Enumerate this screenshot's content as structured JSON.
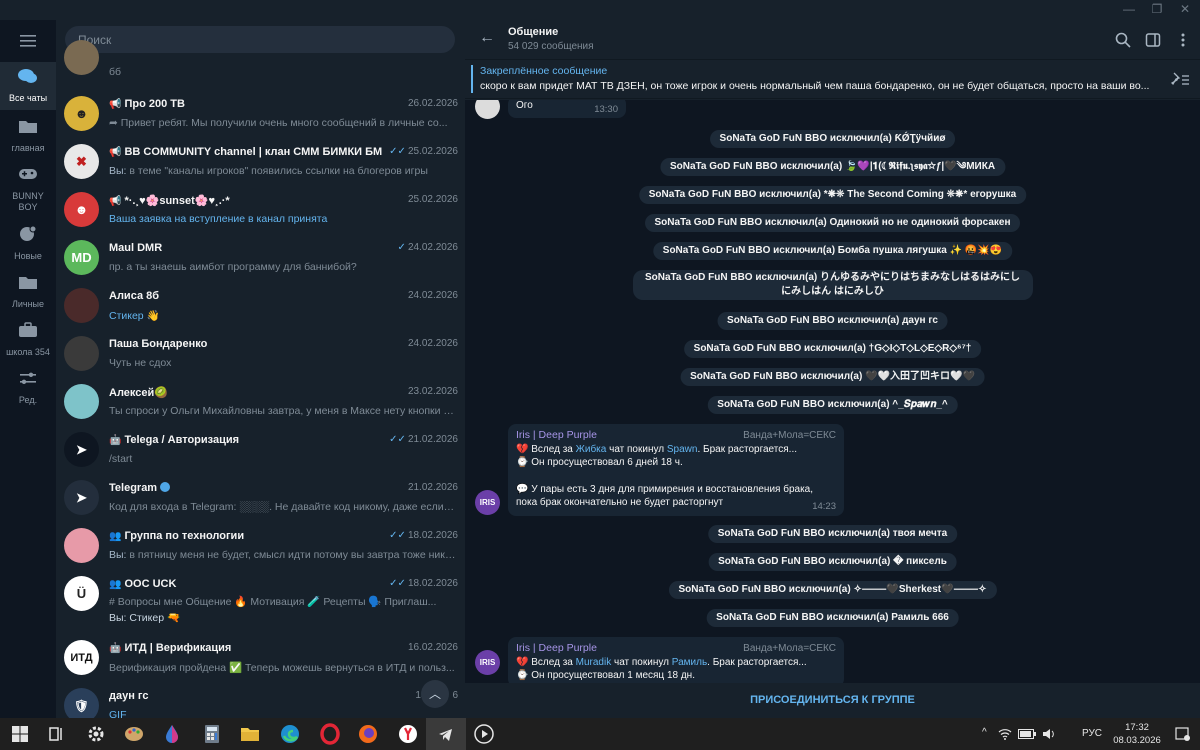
{
  "rail": {
    "items": [
      {
        "label": "Все чаты",
        "icon": "chat-bubbles-icon"
      },
      {
        "label": "главная",
        "icon": "folder-icon"
      },
      {
        "label": "BUNNY BOY",
        "icon": "gamepad-icon"
      },
      {
        "label": "Новые",
        "icon": "chat-new-icon"
      },
      {
        "label": "Личные",
        "icon": "folder-icon"
      },
      {
        "label": "школа 354",
        "icon": "briefcase-icon"
      },
      {
        "label": "Ред.",
        "icon": "sliders-icon"
      }
    ]
  },
  "search": {
    "placeholder": "Поиск"
  },
  "chats": [
    {
      "name": "",
      "date": "",
      "msg": "бб"
    },
    {
      "name": "Про 200 ТВ",
      "date": "26.02.2026",
      "msg": "Привет ребят. Мы получили очень много сообщений в личные со..."
    },
    {
      "name": "BB COMMUNITY channel | клан СММ БИМКИ БМ",
      "date": "25.02.2026",
      "sender": "Вы:",
      "msg": "в теме \"каналы игроков\" появились ссылки на блогеров игры"
    },
    {
      "name": "*·.¸♥🌸sunset🌸♥¸.·*",
      "date": "25.02.2026",
      "msg": "Ваша заявка на вступление в канал принята"
    },
    {
      "name": "Maul DMR",
      "initials": "MD",
      "date": "24.02.2026",
      "msg": "пр. а ты знаешь аимбот программу для баннибой?"
    },
    {
      "name": "Алиса 8б",
      "date": "24.02.2026",
      "msg": "Стикер 👋"
    },
    {
      "name": "Паша Бондаренко",
      "date": "24.02.2026",
      "msg": "Чуть не сдох"
    },
    {
      "name": "Алексей🥝",
      "date": "23.02.2026",
      "msg": "Ты спроси у Ольги Михайловны завтра, у меня в Максе нету кнопки д..."
    },
    {
      "name": "Telega / Авторизация",
      "date": "21.02.2026",
      "msg": "/start"
    },
    {
      "name": "Telegram",
      "date": "21.02.2026",
      "msg": "Код для входа в Telegram: ░░░░. Не давайте код никому, даже если ег..."
    },
    {
      "name": "Группа по технологии",
      "date": "18.02.2026",
      "sender": "Вы:",
      "msg": "в пятницу меня не будет, смысл идти потому вы завтра тоже никт..."
    },
    {
      "name": "OOC UCK",
      "date": "18.02.2026",
      "msg": "# Вопросы мне  Общение  🔥 Мотивация  🧪 Рецепты  🗣️ Приглаш...",
      "msg2": "Вы: Стикер 🔫"
    },
    {
      "name": "ИТД | Верификация",
      "initials": "ИТД",
      "date": "16.02.2026",
      "msg": "Верификация пройдена ✅  Теперь можешь вернуться в ИТД и польз..."
    },
    {
      "name": "даун гс",
      "date": "13",
      "date_tail": "6",
      "msg": "GIF"
    }
  ],
  "header": {
    "title": "Общение",
    "subtitle": "54 029 сообщения"
  },
  "pinned": {
    "title": "Закреплённое сообщение",
    "text": "скоро к вам придет МАТ ТВ ДЗЕН, он тоже игрок и очень нормальный чем паша бондаренко, он не будет общаться, просто на ваши во..."
  },
  "messages": {
    "first": {
      "text": "Ого",
      "time": "13:30"
    },
    "service": [
      "SoNaTa GoD FuN BBO исключил(а) ƘǾƮӱчйиø",
      "SoNaTa GoD FuN BBO исключил(а) 🍃💜|𝟏(☾𝕽𝖎𝖋𝖚.ʅ𝖘𝖞𝖆✩ƒ|🖤༄МИКА",
      "SoNaTa GoD FuN BBO исключил(а) *❋❊ The Second Coming ❊❋* егорушка",
      "SoNaTa GoD FuN BBO исключил(а) Одинокий но не одинокий форсакен",
      "SoNaTa GoD FuN BBO исключил(а) Бомба пушка лягушка ✨ 🤬💥😍",
      "SoNaTa GoD FuN BBO исключил(а) りんゆるみやにりはちまみなしはるはみにしにみしはん はにみしひ",
      "SoNaTa GoD FuN BBO исключил(а)      даун гс",
      "SoNaTa GoD FuN BBO исключил(а) †G◇I◇T◇L◇E◇R◇⁶⁷†",
      "SoNaTa GoD FuN BBO исключил(а) 🖤🤍入田了凹キロ🤍🖤",
      "SoNaTa GoD FuN BBO исключил(а) ^_𝑺𝒑𝒂𝒘𝒏_^",
      "SoNaTa GoD FuN BBO исключил(а) твоя мечта",
      "SoNaTa GoD FuN BBO исключил(а) � пиксель",
      "SoNaTa GoD FuN BBO исключил(а) ✧⸻🖤Sherkest🖤⸻✧",
      "SoNaTa GoD FuN BBO исключил(а) Рамиль 666"
    ],
    "iris1": {
      "from": "Iris | Deep Purple",
      "tag": "Ванда+Мола=СЕКС",
      "l1a": "💔 Вслед за ",
      "l1b": "Жибка",
      "l1c": " чат покинул ",
      "l1d": "Spawn",
      "l1e": ". Брак расторгается...",
      "l2": "⌚ Он просуществовал 6 дней 18 ч.",
      "l3": "💬 У пары есть 3 дня для примирения и восстановления брака,",
      "l4": "пока брак окончательно не будет расторгнут",
      "time": "14:23"
    },
    "iris2": {
      "from": "Iris | Deep Purple",
      "tag": "Ванда+Мола=СЕКС",
      "l1a": "💔 Вслед за ",
      "l1b": "Muradik",
      "l1c": " чат покинул ",
      "l1d": "Рамиль",
      "l1e": ". Брак расторгается...",
      "l2": "⌚ Он просуществовал 1 месяц 18 дн."
    },
    "iris_avatar_text": "IRIS"
  },
  "join_button": "ПРИСОЕДИНИТЬСЯ К ГРУППЕ",
  "taskbar": {
    "lang": "РУС",
    "time": "17:32",
    "date": "08.03.2026"
  },
  "colors": {
    "accent": "#64b5ef",
    "bg_dark": "#0e1621",
    "panel": "#17212b",
    "iris_name": "#a695e7"
  }
}
